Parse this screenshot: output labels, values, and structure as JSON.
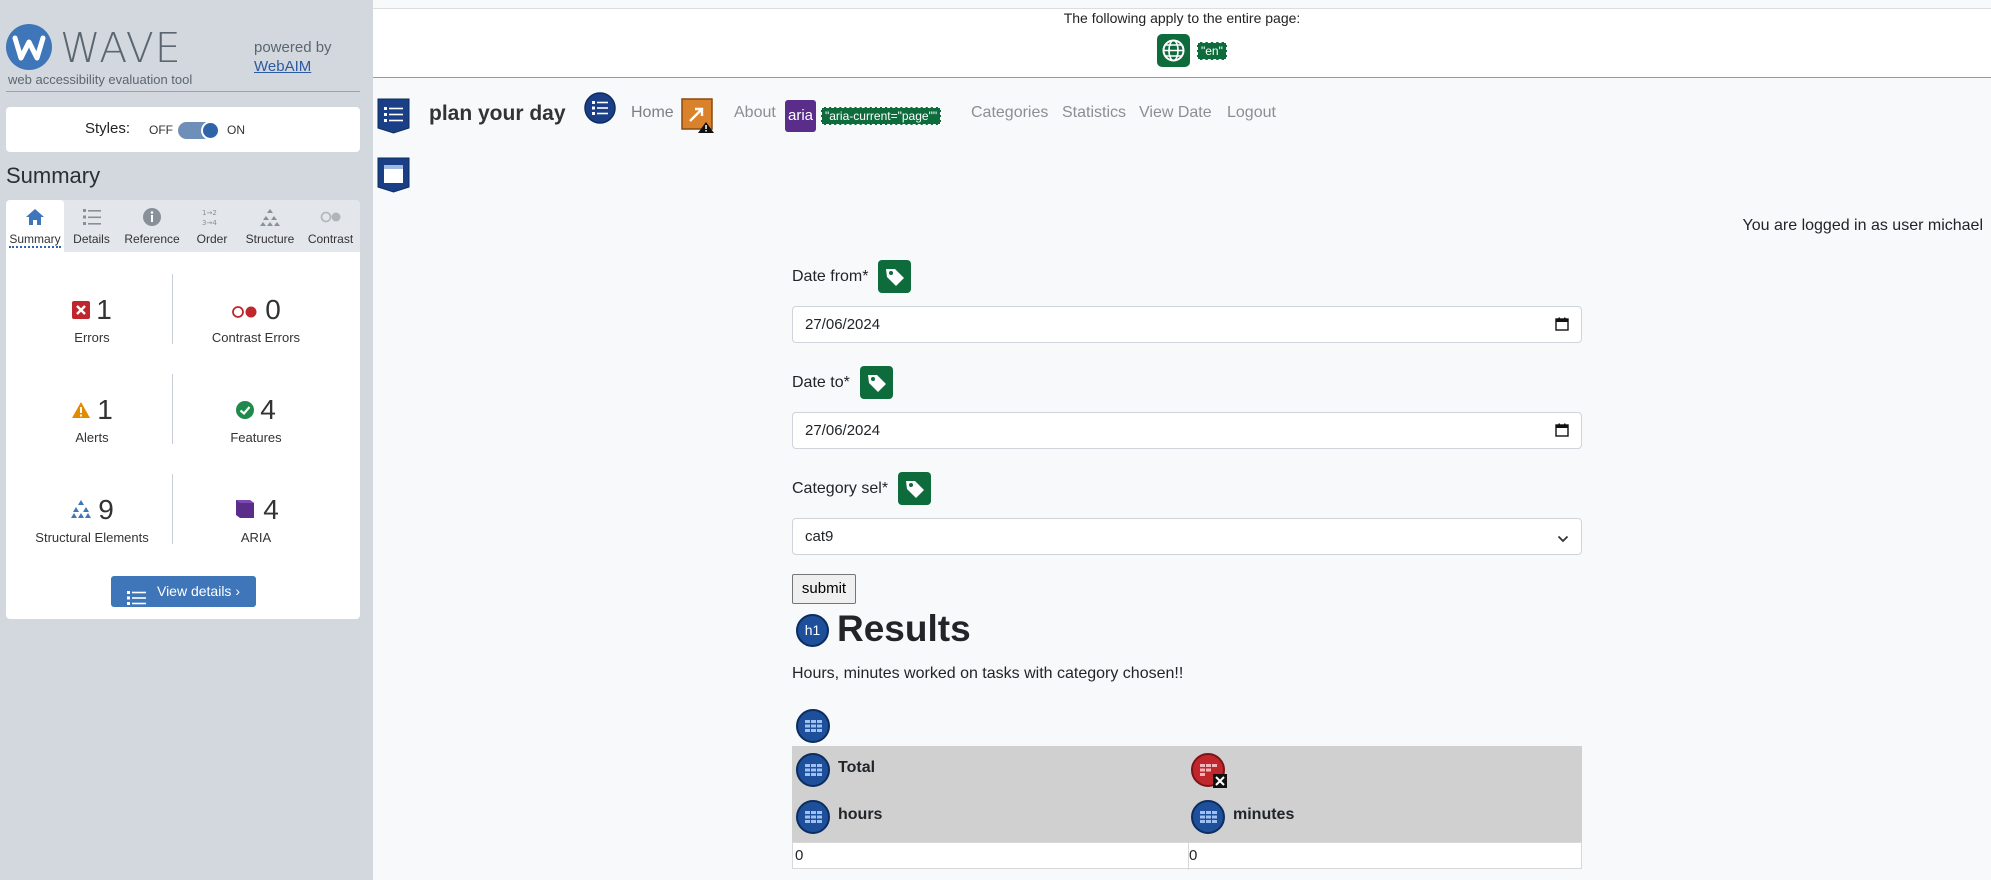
{
  "wave": {
    "logo_word": "WAVE",
    "tagline": "web accessibility evaluation tool",
    "powered_by": "powered by",
    "webaim_link": "WebAIM",
    "styles_label": "Styles:",
    "styles_off": "OFF",
    "styles_on": "ON",
    "summary_title": "Summary",
    "tabs": [
      {
        "label": "Summary",
        "icon": "home-icon",
        "active": true
      },
      {
        "label": "Details",
        "icon": "list-icon",
        "active": false
      },
      {
        "label": "Reference",
        "icon": "info-icon",
        "active": false
      },
      {
        "label": "Order",
        "icon": "order-icon",
        "active": false
      },
      {
        "label": "Structure",
        "icon": "structure-icon",
        "active": false
      },
      {
        "label": "Contrast",
        "icon": "contrast-icon",
        "active": false
      }
    ],
    "stats": {
      "errors": {
        "count": "1",
        "label": "Errors"
      },
      "contrast": {
        "count": "0",
        "label": "Contrast Errors"
      },
      "alerts": {
        "count": "1",
        "label": "Alerts"
      },
      "features": {
        "count": "4",
        "label": "Features"
      },
      "structure": {
        "count": "9",
        "label": "Structural Elements"
      },
      "aria": {
        "count": "4",
        "label": "ARIA"
      }
    },
    "view_details": "View details ›",
    "colors": {
      "accent": "#3f75b9",
      "error": "#c0272d",
      "alert": "#e28a00",
      "feature": "#0e6b3c",
      "aria": "#5b2d8a"
    }
  },
  "page": {
    "banner_text": "The following apply to the entire page:",
    "lang_tag": "\"en\"",
    "brand": "plan your day",
    "nav": {
      "home": "Home",
      "about": "About",
      "aria_badge": "aria",
      "aria_current": "\"aria-current=\"page\"\"",
      "categories": "Categories",
      "statistics": "Statistics",
      "view_date": "View Date",
      "logout": "Logout"
    },
    "user_line": "You are logged in as user michael",
    "form": {
      "date_from_label": "Date from*",
      "date_from_value": "27/06/2024",
      "date_to_label": "Date to*",
      "date_to_value": "27/06/2024",
      "category_label": "Category sel*",
      "category_value": "cat9",
      "submit": "submit"
    },
    "results": {
      "h1_badge": "h1",
      "title": "Results",
      "subtitle": "Hours, minutes worked on tasks with category chosen!!",
      "headers": {
        "total": "Total",
        "hours": "hours",
        "minutes": "minutes"
      },
      "row": {
        "hours": "0",
        "minutes": "0"
      }
    }
  }
}
